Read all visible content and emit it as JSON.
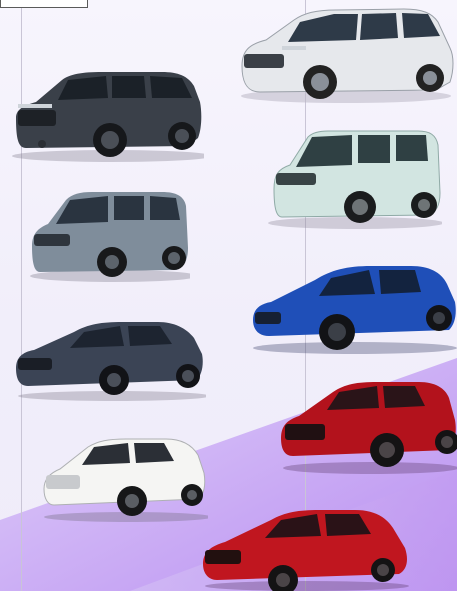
{
  "scene": {
    "background_color": "#f4f1fb",
    "accent_purple": "#c7a8f3",
    "divider_color": "#c9c5d6"
  },
  "vehicles": [
    {
      "name": "minivan-silver",
      "body_color": "#e4e6ea"
    },
    {
      "name": "suv-dark-gray",
      "body_color": "#3a4049"
    },
    {
      "name": "van-light-mint",
      "body_color": "#cfe3df"
    },
    {
      "name": "minivan-steel-blue",
      "body_color": "#7a8a9a"
    },
    {
      "name": "hatchback-blue",
      "body_color": "#1f4fb8"
    },
    {
      "name": "sedan-dark-slate",
      "body_color": "#3b4455"
    },
    {
      "name": "crossover-red",
      "body_color": "#b3121c"
    },
    {
      "name": "crossover-white",
      "body_color": "#f5f5f3"
    },
    {
      "name": "sedan-red",
      "body_color": "#c0161f"
    }
  ]
}
